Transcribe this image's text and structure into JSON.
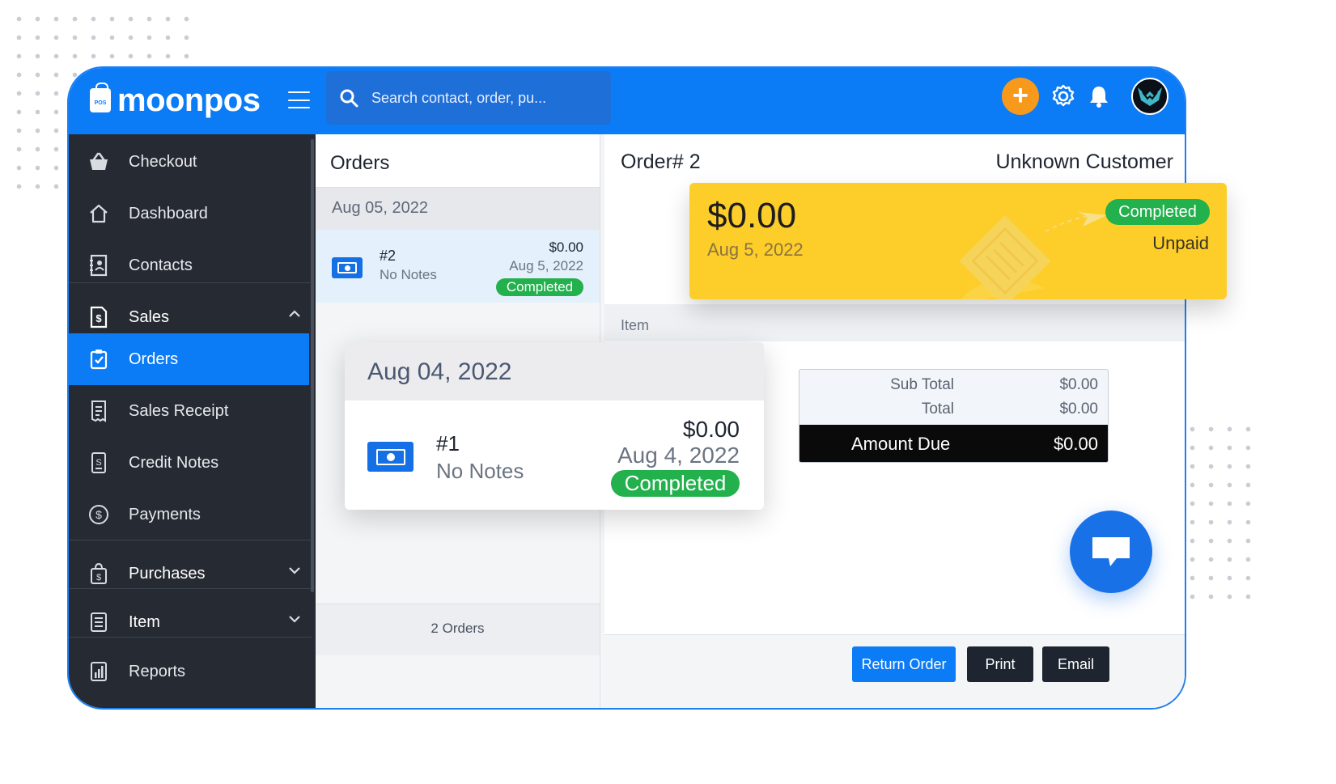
{
  "app": {
    "logo_text": "moonpos",
    "logo_badge": "POS"
  },
  "search": {
    "placeholder": "Search contact, order, pu..."
  },
  "sidebar": {
    "items": [
      {
        "label": "Checkout"
      },
      {
        "label": "Dashboard"
      },
      {
        "label": "Contacts"
      },
      {
        "label": "Sales"
      },
      {
        "label": "Orders"
      },
      {
        "label": "Sales Receipt"
      },
      {
        "label": "Credit Notes"
      },
      {
        "label": "Payments"
      },
      {
        "label": "Purchases"
      },
      {
        "label": "Item"
      },
      {
        "label": "Reports"
      }
    ]
  },
  "orders": {
    "title": "Orders",
    "group_date": "Aug 05, 2022",
    "row": {
      "number": "#2",
      "notes": "No Notes",
      "amount": "$0.00",
      "date": "Aug 5, 2022",
      "status": "Completed"
    },
    "count": "2 Orders"
  },
  "detail": {
    "title": "Order# 2",
    "customer": "Unknown Customer",
    "item_header": "Item",
    "subtotal_label": "Sub Total",
    "subtotal_value": "$0.00",
    "total_label": "Total",
    "total_value": "$0.00",
    "amount_due_label": "Amount Due",
    "amount_due_value": "$0.00",
    "buttons": {
      "return": "Return Order",
      "print": "Print",
      "email": "Email"
    }
  },
  "summary_card": {
    "amount": "$0.00",
    "date": "Aug 5, 2022",
    "status": "Completed",
    "payment": "Unpaid"
  },
  "popup": {
    "group_date": "Aug 04, 2022",
    "number": "#1",
    "notes": "No Notes",
    "amount": "$0.00",
    "date": "Aug 4, 2022",
    "status": "Completed"
  },
  "colors": {
    "brand": "#0b7bf6",
    "sidebar": "#262b33",
    "success": "#22b14c",
    "accent_orange": "#f79a1c",
    "card_yellow": "#fdcd29"
  }
}
